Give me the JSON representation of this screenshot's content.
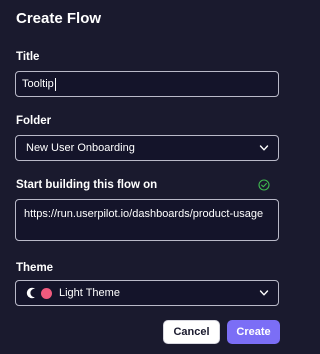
{
  "dialog": {
    "title": "Create Flow"
  },
  "title_field": {
    "label": "Title",
    "value": "Tooltip"
  },
  "folder_field": {
    "label": "Folder",
    "selected": "New User Onboarding"
  },
  "url_field": {
    "label": "Start building this flow on",
    "value": "https://run.userpilot.io/dashboards/product-usage",
    "status_icon": "check-circle-icon",
    "status_color": "#3fb950"
  },
  "theme_field": {
    "label": "Theme",
    "selected": "Light Theme",
    "swatch_color": "#f05a7e"
  },
  "actions": {
    "cancel_label": "Cancel",
    "create_label": "Create"
  },
  "colors": {
    "background": "#1a1a2e",
    "accent": "#7b6ef6"
  }
}
